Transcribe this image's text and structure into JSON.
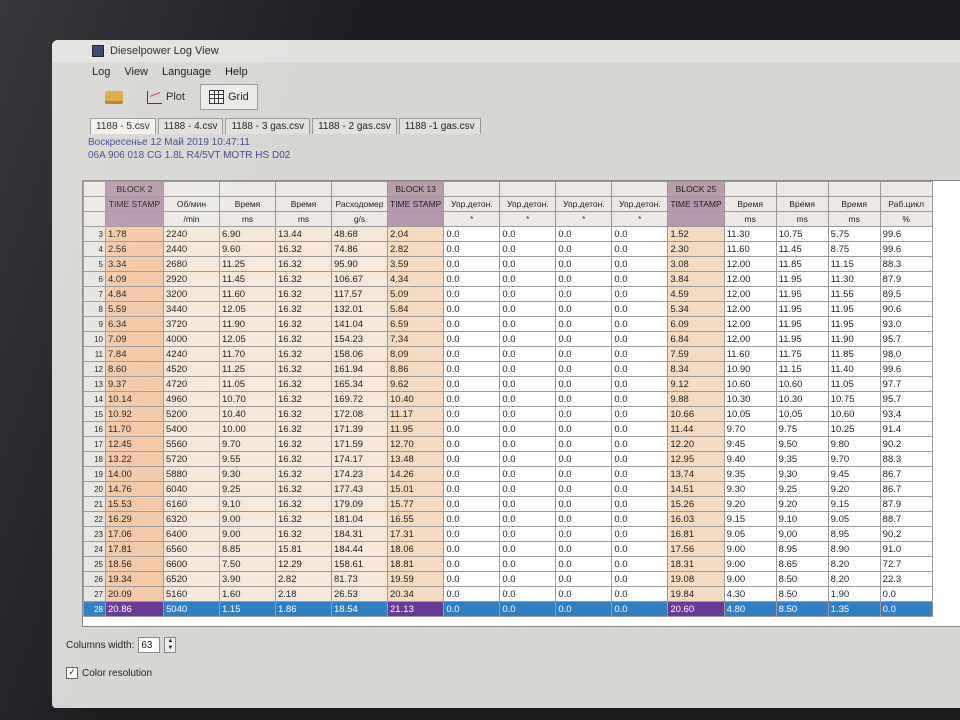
{
  "window": {
    "title": "Dieselpower Log View"
  },
  "menu": [
    "Log",
    "View",
    "Language",
    "Help"
  ],
  "toolbar": {
    "plot_label": "Plot",
    "grid_label": "Grid"
  },
  "tabs": [
    "1188 - 5.csv",
    "1188 - 4.csv",
    "1188 - 3 gas.csv",
    "1188 - 2 gas.csv",
    "1188 -1 gas.csv"
  ],
  "info": {
    "date": "Воскресенье 12 Май 2019 10:47:11",
    "ecu": "06A 906 018 CG  1.8L R4/5VT MOTR HS D02"
  },
  "grid": {
    "blocks": {
      "b2": "BLOCK 2",
      "b13": "BLOCK 13",
      "b25": "BLOCK 25"
    },
    "headers": [
      [
        "TIME STAMP",
        ""
      ],
      [
        "Об/мин",
        "/min"
      ],
      [
        "Время",
        "ms"
      ],
      [
        "Время",
        "ms"
      ],
      [
        "Расходомер",
        "g/s"
      ],
      [
        "TIME STAMP",
        ""
      ],
      [
        "Упр.детон.",
        "*"
      ],
      [
        "Упр.детон.",
        "*"
      ],
      [
        "Упр.детон.",
        "*"
      ],
      [
        "Упр.детон.",
        "*"
      ],
      [
        "TIME STAMP",
        ""
      ],
      [
        "Время",
        "ms"
      ],
      [
        "Время",
        "ms"
      ],
      [
        "Время",
        "ms"
      ],
      [
        "Раб.цикл",
        "%"
      ]
    ],
    "rows": [
      [
        "3",
        "1.78",
        "2240",
        "6.90",
        "13.44",
        "48.68",
        "2.04",
        "0.0",
        "0.0",
        "0.0",
        "0.0",
        "1.52",
        "11.30",
        "10.75",
        "5.75",
        "99.6"
      ],
      [
        "4",
        "2.56",
        "2440",
        "9.60",
        "16.32",
        "74.86",
        "2.82",
        "0.0",
        "0.0",
        "0.0",
        "0.0",
        "2.30",
        "11.60",
        "11.45",
        "8.75",
        "99.6"
      ],
      [
        "5",
        "3.34",
        "2680",
        "11.25",
        "16.32",
        "95.90",
        "3.59",
        "0.0",
        "0.0",
        "0.0",
        "0.0",
        "3.08",
        "12.00",
        "11.85",
        "11.15",
        "88.3"
      ],
      [
        "6",
        "4.09",
        "2920",
        "11.45",
        "16.32",
        "106.67",
        "4.34",
        "0.0",
        "0.0",
        "0.0",
        "0.0",
        "3.84",
        "12.00",
        "11.95",
        "11.30",
        "87.9"
      ],
      [
        "7",
        "4.84",
        "3200",
        "11.60",
        "16.32",
        "117.57",
        "5.09",
        "0.0",
        "0.0",
        "0.0",
        "0.0",
        "4.59",
        "12.00",
        "11.95",
        "11.55",
        "89.5"
      ],
      [
        "8",
        "5.59",
        "3440",
        "12.05",
        "16.32",
        "132.01",
        "5.84",
        "0.0",
        "0.0",
        "0.0",
        "0.0",
        "5.34",
        "12.00",
        "11.95",
        "11.95",
        "90.6"
      ],
      [
        "9",
        "6.34",
        "3720",
        "11.90",
        "16.32",
        "141.04",
        "6.59",
        "0.0",
        "0.0",
        "0.0",
        "0.0",
        "6.09",
        "12.00",
        "11.95",
        "11.95",
        "93.0"
      ],
      [
        "10",
        "7.09",
        "4000",
        "12.05",
        "16.32",
        "154.23",
        "7.34",
        "0.0",
        "0.0",
        "0.0",
        "0.0",
        "6.84",
        "12.00",
        "11.95",
        "11.90",
        "95.7"
      ],
      [
        "11",
        "7.84",
        "4240",
        "11.70",
        "16.32",
        "158.06",
        "8.09",
        "0.0",
        "0.0",
        "0.0",
        "0.0",
        "7.59",
        "11.60",
        "11.75",
        "11.85",
        "98.0"
      ],
      [
        "12",
        "8.60",
        "4520",
        "11.25",
        "16.32",
        "161.94",
        "8.86",
        "0.0",
        "0.0",
        "0.0",
        "0.0",
        "8.34",
        "10.90",
        "11.15",
        "11.40",
        "99.6"
      ],
      [
        "13",
        "9.37",
        "4720",
        "11.05",
        "16.32",
        "165.34",
        "9.62",
        "0.0",
        "0.0",
        "0.0",
        "0.0",
        "9.12",
        "10.60",
        "10.60",
        "11.05",
        "97.7"
      ],
      [
        "14",
        "10.14",
        "4960",
        "10.70",
        "16.32",
        "169.72",
        "10.40",
        "0.0",
        "0.0",
        "0.0",
        "0.0",
        "9.88",
        "10.30",
        "10.30",
        "10.75",
        "95.7"
      ],
      [
        "15",
        "10.92",
        "5200",
        "10.40",
        "16.32",
        "172.08",
        "11.17",
        "0.0",
        "0.0",
        "0.0",
        "0.0",
        "10.66",
        "10.05",
        "10.05",
        "10.60",
        "93.4"
      ],
      [
        "16",
        "11.70",
        "5400",
        "10.00",
        "16.32",
        "171.39",
        "11.95",
        "0.0",
        "0.0",
        "0.0",
        "0.0",
        "11.44",
        "9.70",
        "9.75",
        "10.25",
        "91.4"
      ],
      [
        "17",
        "12.45",
        "5560",
        "9.70",
        "16.32",
        "171.59",
        "12.70",
        "0.0",
        "0.0",
        "0.0",
        "0.0",
        "12.20",
        "9.45",
        "9.50",
        "9.80",
        "90.2"
      ],
      [
        "18",
        "13.22",
        "5720",
        "9.55",
        "16.32",
        "174.17",
        "13.48",
        "0.0",
        "0.0",
        "0.0",
        "0.0",
        "12.95",
        "9.40",
        "9.35",
        "9.70",
        "88.3"
      ],
      [
        "19",
        "14.00",
        "5880",
        "9.30",
        "16.32",
        "174.23",
        "14.26",
        "0.0",
        "0.0",
        "0.0",
        "0.0",
        "13.74",
        "9.35",
        "9.30",
        "9.45",
        "86.7"
      ],
      [
        "20",
        "14.76",
        "6040",
        "9.25",
        "16.32",
        "177.43",
        "15.01",
        "0.0",
        "0.0",
        "0.0",
        "0.0",
        "14.51",
        "9.30",
        "9.25",
        "9.20",
        "86.7"
      ],
      [
        "21",
        "15.53",
        "6160",
        "9.10",
        "16.32",
        "179.09",
        "15.77",
        "0.0",
        "0.0",
        "0.0",
        "0.0",
        "15.26",
        "9.20",
        "9.20",
        "9.15",
        "87.9"
      ],
      [
        "22",
        "16.29",
        "6320",
        "9.00",
        "16.32",
        "181.04",
        "16.55",
        "0.0",
        "0.0",
        "0.0",
        "0.0",
        "16.03",
        "9.15",
        "9.10",
        "9.05",
        "88.7"
      ],
      [
        "23",
        "17.06",
        "6400",
        "9.00",
        "16.32",
        "184.31",
        "17.31",
        "0.0",
        "0.0",
        "0.0",
        "0.0",
        "16.81",
        "9.05",
        "9.00",
        "8.95",
        "90.2"
      ],
      [
        "24",
        "17.81",
        "6560",
        "8.85",
        "15.81",
        "184.44",
        "18.06",
        "0.0",
        "0.0",
        "0.0",
        "0.0",
        "17.56",
        "9.00",
        "8.95",
        "8.90",
        "91.0"
      ],
      [
        "25",
        "18.56",
        "6600",
        "7.50",
        "12.29",
        "158.61",
        "18.81",
        "0.0",
        "0.0",
        "0.0",
        "0.0",
        "18.31",
        "9.00",
        "8.65",
        "8.20",
        "72.7"
      ],
      [
        "26",
        "19.34",
        "6520",
        "3.90",
        "2.82",
        "81.73",
        "19.59",
        "0.0",
        "0.0",
        "0.0",
        "0.0",
        "19.08",
        "9.00",
        "8.50",
        "8.20",
        "22.3"
      ],
      [
        "27",
        "20.09",
        "5160",
        "1.60",
        "2.18",
        "26.53",
        "20.34",
        "0.0",
        "0.0",
        "0.0",
        "0.0",
        "19.84",
        "4.30",
        "8.50",
        "1.90",
        "0.0"
      ],
      [
        "28",
        "20.86",
        "5040",
        "1.15",
        "1.86",
        "18.54",
        "21.13",
        "0.0",
        "0.0",
        "0.0",
        "0.0",
        "20.60",
        "4.80",
        "8.50",
        "1.35",
        "0.0"
      ]
    ]
  },
  "bottom": {
    "columns_width_label": "Columns width:",
    "columns_width_value": "63",
    "color_resolution_label": "Color resolution"
  }
}
